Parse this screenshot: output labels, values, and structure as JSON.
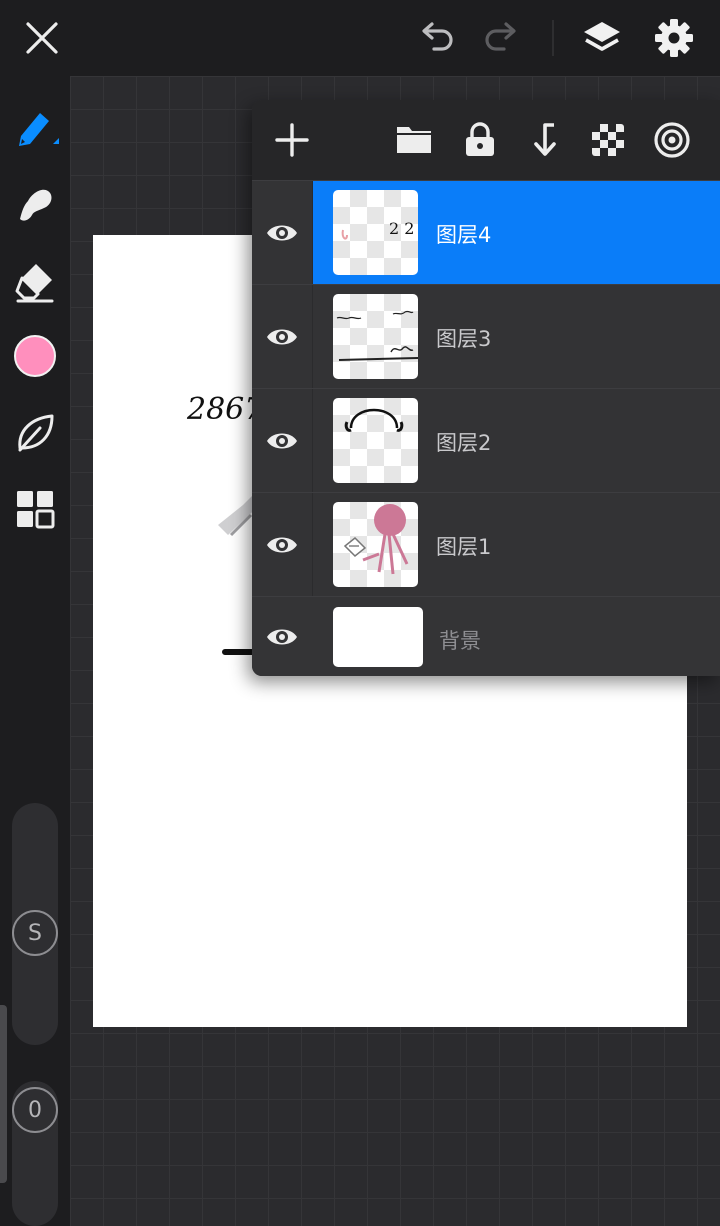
{
  "topbar": {
    "close": "close-icon",
    "undo": "undo-icon",
    "redo": "redo-icon",
    "layers": "layers-icon",
    "settings": "gear-icon"
  },
  "tools": {
    "brush": "brush-icon",
    "smudge": "smudge-icon",
    "eraser": "eraser-icon",
    "color": "#ff8fbd",
    "blend": "leaf-icon",
    "materials": "grid-icon",
    "size_knob": "S",
    "opacity_knob": "0"
  },
  "layers_panel": {
    "toolbar": [
      "add-layer-icon",
      "folder-icon",
      "lock-icon",
      "merge-down-icon",
      "transparency-icon",
      "blend-mode-icon"
    ],
    "layers": [
      {
        "name": "图层4",
        "visible": true,
        "selected": true
      },
      {
        "name": "图层3",
        "visible": true,
        "selected": false
      },
      {
        "name": "图层2",
        "visible": true,
        "selected": false
      },
      {
        "name": "图层1",
        "visible": true,
        "selected": false
      }
    ],
    "background": {
      "name": "背景",
      "visible": true
    }
  },
  "canvas": {
    "sketch_text": "2867"
  },
  "colors": {
    "accent": "#0a7df9",
    "brush_color": "#ff8fbd"
  }
}
